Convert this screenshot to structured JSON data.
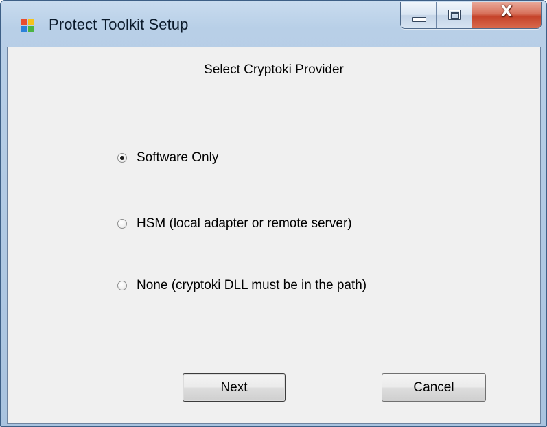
{
  "window": {
    "title": "Protect Toolkit Setup",
    "icon": "setup-app-icon",
    "controls": {
      "minimize_icon": "minimize-icon",
      "maximize_icon": "maximize-icon",
      "close_icon": "close-icon",
      "close_glyph": "X"
    }
  },
  "dialog": {
    "heading": "Select Cryptoki Provider",
    "options": [
      {
        "label": "Software Only",
        "selected": true
      },
      {
        "label": "HSM (local adapter or remote server)",
        "selected": false
      },
      {
        "label": "None (cryptoki DLL must be in the path)",
        "selected": false
      }
    ],
    "buttons": {
      "next": "Next",
      "cancel": "Cancel"
    }
  },
  "colors": {
    "client_background": "#f0f0f0",
    "frame": "#b8cfe7",
    "close_button": "#c5432a"
  }
}
